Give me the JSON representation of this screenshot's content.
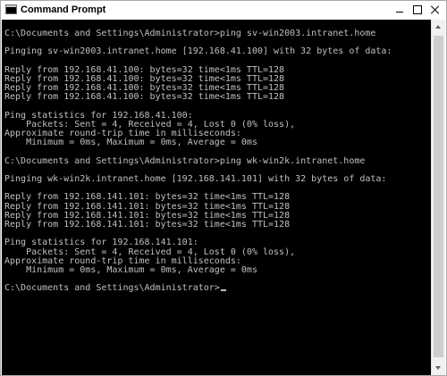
{
  "window": {
    "title": "Command Prompt",
    "icon": "cmd-icon"
  },
  "title_controls": {
    "minimize_icon": "minimize-icon",
    "maximize_icon": "maximize-icon",
    "close_icon": "close-icon"
  },
  "colors": {
    "console_background": "#000000",
    "console_text": "#c0c0c0",
    "titlebar_background": "#ffffff"
  },
  "console": {
    "lines": [
      "C:\\Documents and Settings\\Administrator>ping sv-win2003.intranet.home",
      "",
      "Pinging sv-win2003.intranet.home [192.168.41.100] with 32 bytes of data:",
      "",
      "Reply from 192.168.41.100: bytes=32 time<1ms TTL=128",
      "Reply from 192.168.41.100: bytes=32 time<1ms TTL=128",
      "Reply from 192.168.41.100: bytes=32 time<1ms TTL=128",
      "Reply from 192.168.41.100: bytes=32 time<1ms TTL=128",
      "",
      "Ping statistics for 192.168.41.100:",
      "    Packets: Sent = 4, Received = 4, Lost 0 (0% loss),",
      "Approximate round-trip time in milliseconds:",
      "    Minimum = 0ms, Maximum = 0ms, Average = 0ms",
      "",
      "C:\\Documents and Settings\\Administrator>ping wk-win2k.intranet.home",
      "",
      "Pinging wk-win2k.intranet.home [192.168.141.101] with 32 bytes of data:",
      "",
      "Reply from 192.168.141.101: bytes=32 time<1ms TTL=128",
      "Reply from 192.168.141.101: bytes=32 time<1ms TTL=128",
      "Reply from 192.168.141.101: bytes=32 time<1ms TTL=128",
      "Reply from 192.168.141.101: bytes=32 time<1ms TTL=128",
      "",
      "Ping statistics for 192.168.141.101:",
      "    Packets: Sent = 4, Received = 4, Lost 0 (0% loss),",
      "Approximate round-trip time in milliseconds:",
      "    Minimum = 0ms, Maximum = 0ms, Average = 0ms",
      "",
      "C:\\Documents and Settings\\Administrator>"
    ]
  }
}
